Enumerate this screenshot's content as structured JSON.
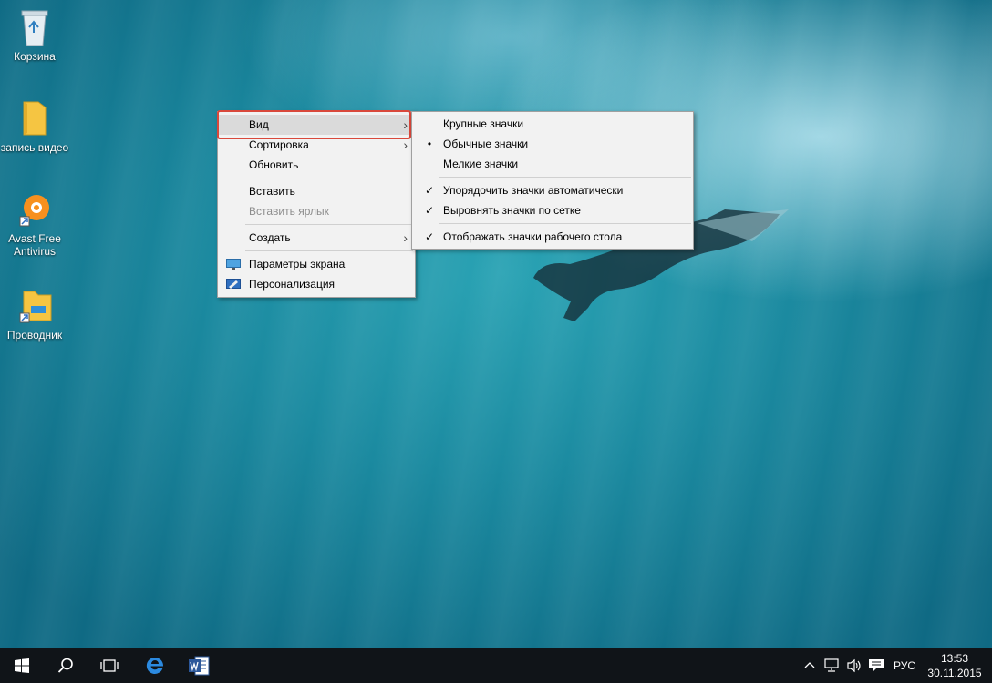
{
  "desktop": {
    "icons": [
      {
        "label": "Корзина",
        "icon": "recycle-bin-icon"
      },
      {
        "label": "запись видео",
        "icon": "folder-icon"
      },
      {
        "label": "Avast Free Antivirus",
        "icon": "avast-icon"
      },
      {
        "label": "Проводник",
        "icon": "file-explorer-icon"
      }
    ]
  },
  "context_menu": {
    "items": [
      {
        "label": "Вид",
        "submenu": true,
        "highlighted": true
      },
      {
        "label": "Сортировка",
        "submenu": true
      },
      {
        "label": "Обновить"
      },
      {
        "label": "Вставить"
      },
      {
        "label": "Вставить ярлык",
        "disabled": true
      },
      {
        "label": "Создать",
        "submenu": true
      },
      {
        "label": "Параметры экрана",
        "icon": "display-settings-icon"
      },
      {
        "label": "Персонализация",
        "icon": "personalization-icon"
      }
    ]
  },
  "view_submenu": {
    "items": [
      {
        "label": "Крупные значки"
      },
      {
        "label": "Обычные значки",
        "mark": "•"
      },
      {
        "label": "Мелкие значки"
      },
      {
        "label": "Упорядочить значки автоматически",
        "mark": "✓"
      },
      {
        "label": "Выровнять значки по сетке",
        "mark": "✓"
      },
      {
        "label": "Отображать значки рабочего стола",
        "mark": "✓"
      }
    ]
  },
  "taskbar": {
    "buttons": [
      "start-icon",
      "search-icon",
      "task-view-icon",
      "edge-icon",
      "word-icon"
    ],
    "tray": {
      "language": "РУС",
      "time": "13:53",
      "date": "30.11.2015"
    }
  },
  "colors": {
    "highlight_border": "#d9483b",
    "taskbar": "#101418",
    "menu_bg": "#f2f2f2"
  }
}
